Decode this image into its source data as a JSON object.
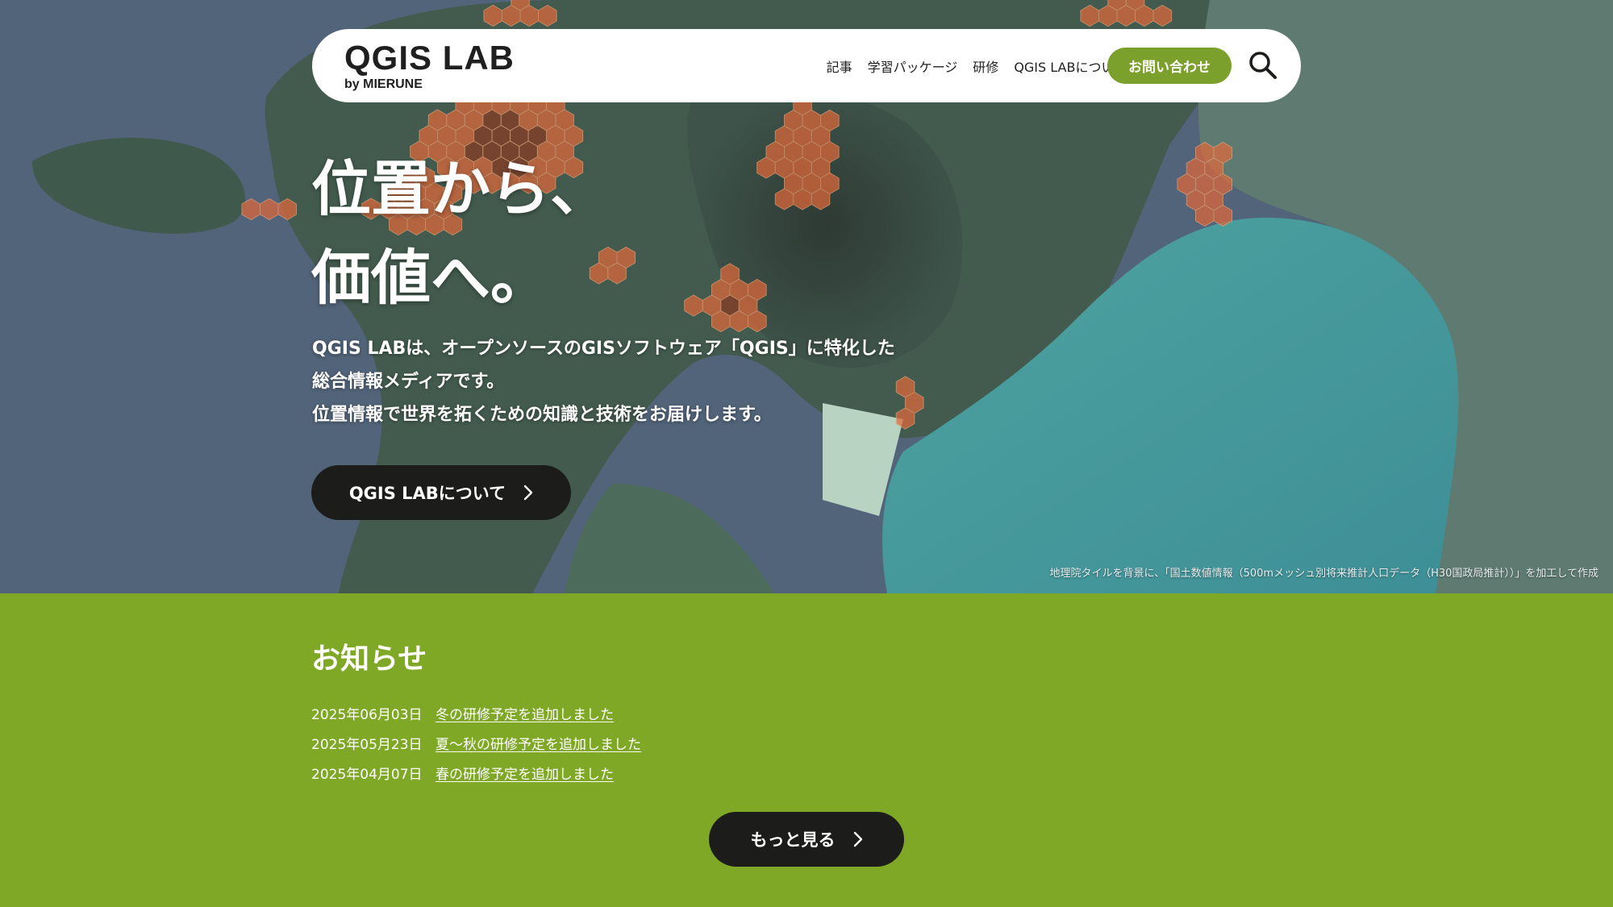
{
  "header": {
    "logo_title": "QGIS LAB",
    "logo_subtitle": "by MIERUNE",
    "nav": [
      {
        "label": "記事"
      },
      {
        "label": "学習パッケージ"
      },
      {
        "label": "研修"
      },
      {
        "label": "QGIS LABについて"
      }
    ],
    "contact_label": "お問い合わせ",
    "search_icon": "search-icon"
  },
  "hero": {
    "title_line1": "位置から、",
    "title_line2": "価値へ。",
    "description": [
      "QGIS LABは、オープンソースのGISソフトウェア「QGIS」に特化した",
      "総合情報メディアです。",
      "位置情報で世界を拓くための知識と技術をお届けします。"
    ],
    "about_button_label": "QGIS LABについて",
    "credit": "地理院タイルを背景に、「国土数値情報（500mメッシュ別将来推計人口データ（H30国政局推計））」を加工して作成"
  },
  "news": {
    "heading": "お知らせ",
    "items": [
      {
        "date": "2025年06月03日",
        "title": "冬の研修予定を追加しました"
      },
      {
        "date": "2025年05月23日",
        "title": "夏〜秋の研修予定を追加しました"
      },
      {
        "date": "2025年04月07日",
        "title": "春の研修予定を追加しました"
      }
    ],
    "more_button_label": "もっと見る"
  },
  "colors": {
    "accent_green": "#7fa827",
    "button_dark": "#1c1c1a",
    "header_bg": "#ffffff",
    "hex_overlay": "#e0683a"
  }
}
